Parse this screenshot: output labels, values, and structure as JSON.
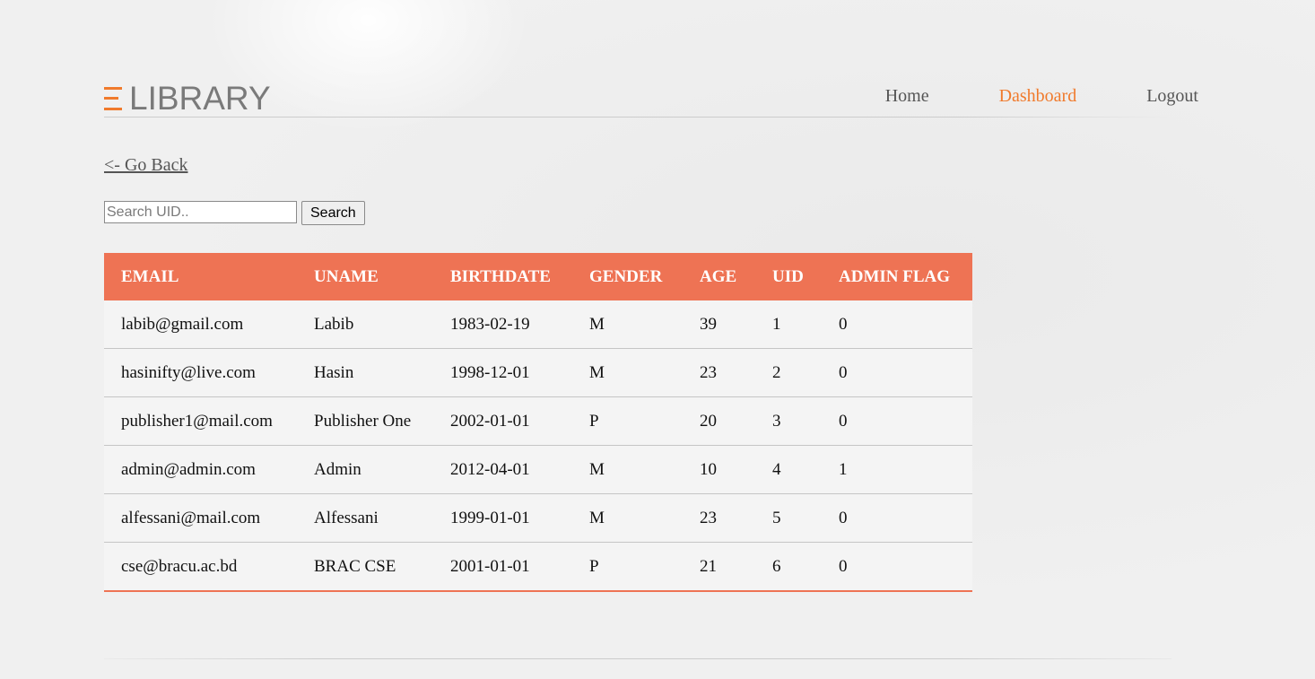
{
  "brand": {
    "name": "LIBRARY",
    "accent_color": "#f07a2c"
  },
  "nav": [
    {
      "label": "Home",
      "active": false
    },
    {
      "label": "Dashboard",
      "active": true
    },
    {
      "label": "Logout",
      "active": false
    }
  ],
  "go_back": "<- Go Back",
  "search": {
    "placeholder": "Search UID..",
    "button_label": "Search"
  },
  "table": {
    "header_color": "#ee7354",
    "columns": [
      "EMAIL",
      "UNAME",
      "BIRTHDATE",
      "GENDER",
      "AGE",
      "UID",
      "ADMIN FLAG"
    ],
    "rows": [
      [
        "labib@gmail.com",
        "Labib",
        "1983-02-19",
        "M",
        "39",
        "1",
        "0"
      ],
      [
        "hasinifty@live.com",
        "Hasin",
        "1998-12-01",
        "M",
        "23",
        "2",
        "0"
      ],
      [
        "publisher1@mail.com",
        "Publisher One",
        "2002-01-01",
        "P",
        "20",
        "3",
        "0"
      ],
      [
        "admin@admin.com",
        "Admin",
        "2012-04-01",
        "M",
        "10",
        "4",
        "1"
      ],
      [
        "alfessani@mail.com",
        "Alfessani",
        "1999-01-01",
        "M",
        "23",
        "5",
        "0"
      ],
      [
        "cse@bracu.ac.bd",
        "BRAC CSE",
        "2001-01-01",
        "P",
        "21",
        "6",
        "0"
      ]
    ]
  }
}
